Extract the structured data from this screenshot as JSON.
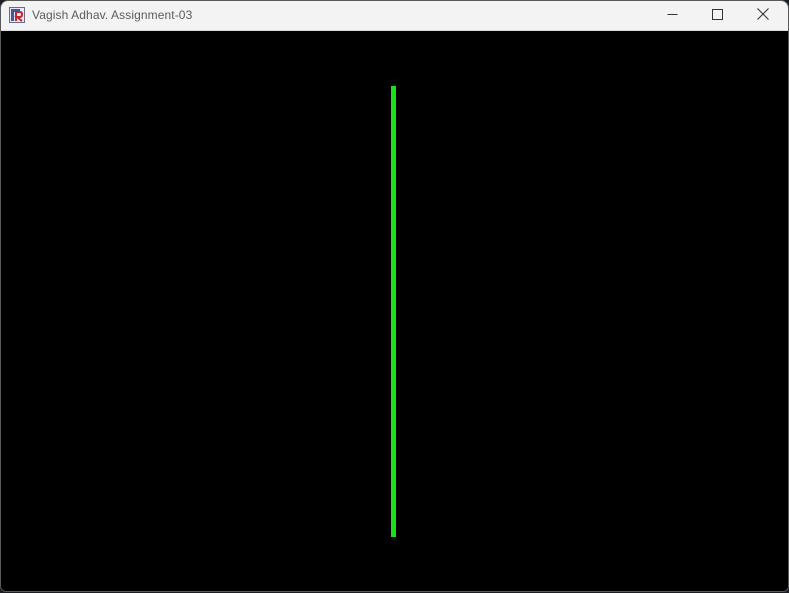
{
  "window": {
    "title": "Vagish Adhav. Assignment-03",
    "app_icon": "r-app-icon",
    "controls": {
      "minimize_icon": "minimize-icon",
      "maximize_icon": "maximize-icon",
      "close_icon": "close-icon"
    }
  },
  "canvas": {
    "background_color": "#000000",
    "line_color": "#19e019"
  }
}
